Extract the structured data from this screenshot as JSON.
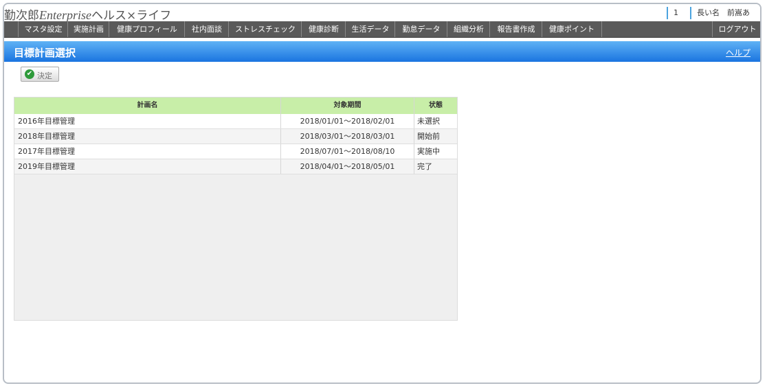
{
  "app": {
    "logo_prefix": "勤次郎",
    "logo_enterprise": "Enterprise",
    "logo_suffix": "ヘルス×ライフ",
    "user_index": "1",
    "user_name": "長い名　前嵩あ"
  },
  "nav": {
    "items": [
      "マスタ設定",
      "実施計画",
      "健康プロフィール",
      "社内面談",
      "ストレスチェック",
      "健康診断",
      "生活データ",
      "勤怠データ",
      "組織分析",
      "報告書作成",
      "健康ポイント"
    ],
    "logout": "ログアウト"
  },
  "page": {
    "title": "目標計画選択",
    "help": "ヘルプ",
    "decide_button": "決定"
  },
  "table": {
    "columns": [
      "計画名",
      "対象期間",
      "状態"
    ],
    "rows": [
      {
        "name": "2016年目標管理",
        "period": "2018/01/01～2018/02/01",
        "status": "未選択"
      },
      {
        "name": "2018年目標管理",
        "period": "2018/03/01～2018/03/01",
        "status": "開始前"
      },
      {
        "name": "2017年目標管理",
        "period": "2018/07/01～2018/08/10",
        "status": "実施中"
      },
      {
        "name": "2019年目標管理",
        "period": "2018/04/01～2018/05/01",
        "status": "完了"
      }
    ]
  },
  "colors": {
    "accent_blue": "#1a74e0",
    "nav_bg": "#5a5a5a",
    "table_header": "#c8eea8",
    "check_green": "#2e9a3a"
  }
}
